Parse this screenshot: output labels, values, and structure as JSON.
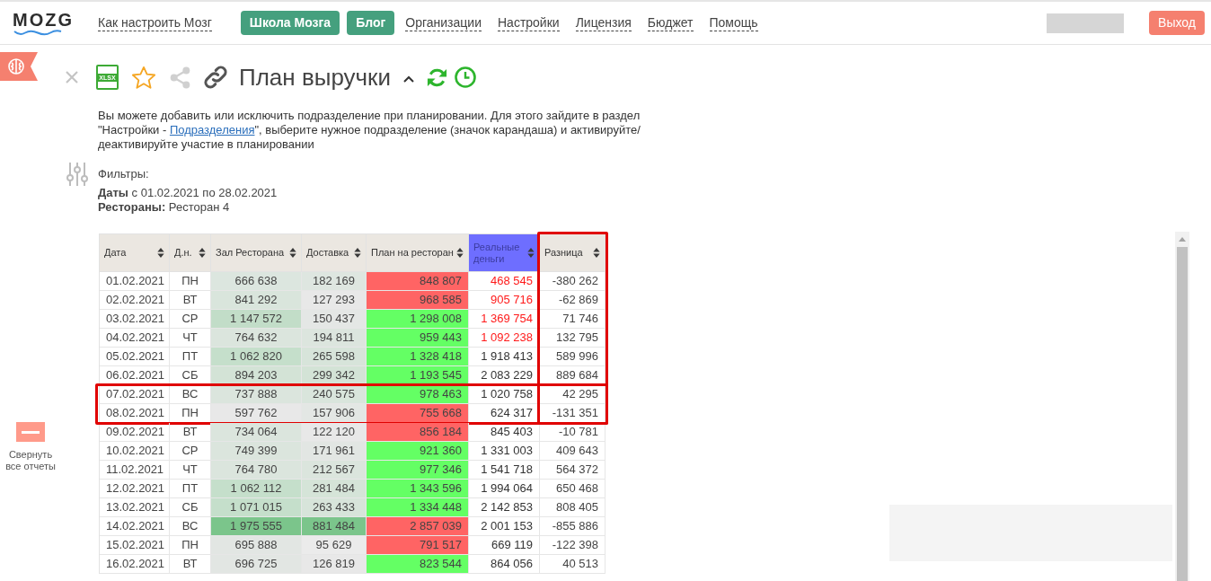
{
  "header": {
    "logo": "MOZG",
    "nav": [
      {
        "kind": "link",
        "label": "Как настроить Мозг"
      },
      {
        "kind": "button",
        "label": "Школа Мозга"
      },
      {
        "kind": "button",
        "label": "Блог"
      },
      {
        "kind": "link",
        "label": "Организации"
      },
      {
        "kind": "link",
        "label": "Настройки"
      },
      {
        "kind": "link",
        "label": "Лицензия"
      },
      {
        "kind": "link",
        "label": "Бюджет"
      },
      {
        "kind": "link",
        "label": "Помощь"
      }
    ],
    "logout": "Выход"
  },
  "sidebar": {
    "collapse_label": "Свернуть все отчеты"
  },
  "report": {
    "export_label": "XLSX",
    "title": "План выручки",
    "notice": {
      "before": "Вы можете добавить или исключить подразделение при планировании. Для этого зайдите в раздел \"Настройки - ",
      "link": "Подразделения",
      "after": "\", выберите нужное подразделение (значок карандаша) и активируйте/деактивируйте участие в планировании"
    },
    "filters": {
      "heading": "Фильтры:",
      "lines": [
        "**Даты** с 01.02.2021 по 28.02.2021",
        "**Рестораны:** Ресторан 4"
      ]
    }
  },
  "table": {
    "columns": [
      {
        "label": "Дата",
        "color": "#ebe7e1",
        "framed": false
      },
      {
        "label": "Д.н.",
        "color": "#ebe7e1",
        "framed": false
      },
      {
        "label": "Зал Ресторана",
        "color": "#ebe7e1",
        "framed": false
      },
      {
        "label": "Доставка",
        "color": "#ebe7e1",
        "framed": false
      },
      {
        "label": "План на ресторан",
        "color": "#ebe7e1",
        "framed": false
      },
      {
        "label": "Реальные деньги",
        "color": "#6e6eff",
        "framed": false
      },
      {
        "label": "Разница",
        "color": "#ebe7e1",
        "framed": true
      }
    ],
    "groups": [
      {
        "framed": false,
        "rows": [
          {
            "date": "01.02.2021",
            "weekday": "ПН",
            "hall": {
              "text": "666 638",
              "color": "#dce6df"
            },
            "delivery": {
              "text": "182 169",
              "color": "#dee6e0"
            },
            "plan": {
              "text": "848 807",
              "color": "#ff6464"
            },
            "real": {
              "text": "468 545",
              "color": "#ff1a1a"
            },
            "diff": "-380 262"
          },
          {
            "date": "02.02.2021",
            "weekday": "ВТ",
            "hall": {
              "text": "841 292",
              "color": "#d9e5dc"
            },
            "delivery": {
              "text": "127 293",
              "color": "#e8e8e8"
            },
            "plan": {
              "text": "968 585",
              "color": "#ff6464"
            },
            "real": {
              "text": "905 716",
              "color": "#ff1a1a"
            },
            "diff": "-62 869"
          },
          {
            "date": "03.02.2021",
            "weekday": "СР",
            "hall": {
              "text": "1 147 572",
              "color": "#c2ddc8"
            },
            "delivery": {
              "text": "150 437",
              "color": "#e4e7e5"
            },
            "plan": {
              "text": "1 298 008",
              "color": "#64ff64"
            },
            "real": {
              "text": "1 369 754",
              "color": "#ff1a1a"
            },
            "diff": "71 746"
          },
          {
            "date": "04.02.2021",
            "weekday": "ЧТ",
            "hall": {
              "text": "764 632",
              "color": "#dbe5dd"
            },
            "delivery": {
              "text": "194 811",
              "color": "#dce5de"
            },
            "plan": {
              "text": "959 443",
              "color": "#64ff64"
            },
            "real": {
              "text": "1 092 238",
              "color": "#ff1a1a"
            },
            "diff": "132 795"
          },
          {
            "date": "05.02.2021",
            "weekday": "ПТ",
            "hall": {
              "text": "1 062 820",
              "color": "#c5dfcb"
            },
            "delivery": {
              "text": "265 598",
              "color": "#d7e4da"
            },
            "plan": {
              "text": "1 328 418",
              "color": "#64ff64"
            },
            "real": {
              "text": "1 918 413",
              "color": "#333333"
            },
            "diff": "589 996"
          },
          {
            "date": "06.02.2021",
            "weekday": "СБ",
            "hall": {
              "text": "894 203",
              "color": "#d3e3d6"
            },
            "delivery": {
              "text": "299 342",
              "color": "#d3e3d6"
            },
            "plan": {
              "text": "1 193 545",
              "color": "#64ff64"
            },
            "real": {
              "text": "2 083 229",
              "color": "#333333"
            },
            "diff": "889 684"
          }
        ]
      },
      {
        "framed": true,
        "rows": [
          {
            "date": "07.02.2021",
            "weekday": "ВС",
            "hall": {
              "text": "737 888",
              "color": "#dbe5dd"
            },
            "delivery": {
              "text": "240 575",
              "color": "#d9e5dc"
            },
            "plan": {
              "text": "978 463",
              "color": "#64ff64"
            },
            "real": {
              "text": "1 020 758",
              "color": "#333333"
            },
            "diff": "42 295"
          },
          {
            "date": "08.02.2021",
            "weekday": "ПН",
            "hall": {
              "text": "597 762",
              "color": "#e8e8e8"
            },
            "delivery": {
              "text": "157 906",
              "color": "#e3e7e4"
            },
            "plan": {
              "text": "755 668",
              "color": "#ff6464"
            },
            "real": {
              "text": "624 317",
              "color": "#333333"
            },
            "diff": "-131 351"
          }
        ]
      },
      {
        "framed": false,
        "rows": [
          {
            "date": "09.02.2021",
            "weekday": "ВТ",
            "hall": {
              "text": "734 064",
              "color": "#dbe5dd"
            },
            "delivery": {
              "text": "122 120",
              "color": "#e8e8e8"
            },
            "plan": {
              "text": "856 184",
              "color": "#ff6464"
            },
            "real": {
              "text": "845 403",
              "color": "#333333"
            },
            "diff": "-10 781"
          },
          {
            "date": "10.02.2021",
            "weekday": "СР",
            "hall": {
              "text": "749 399",
              "color": "#dbe5dd"
            },
            "delivery": {
              "text": "171 961",
              "color": "#e2e6e3"
            },
            "plan": {
              "text": "921 360",
              "color": "#64ff64"
            },
            "real": {
              "text": "1 331 003",
              "color": "#333333"
            },
            "diff": "409 643"
          },
          {
            "date": "11.02.2021",
            "weekday": "ЧТ",
            "hall": {
              "text": "764 780",
              "color": "#dbe5dd"
            },
            "delivery": {
              "text": "212 567",
              "color": "#dbe5dd"
            },
            "plan": {
              "text": "977 346",
              "color": "#64ff64"
            },
            "real": {
              "text": "1 541 718",
              "color": "#333333"
            },
            "diff": "564 372"
          },
          {
            "date": "12.02.2021",
            "weekday": "ПТ",
            "hall": {
              "text": "1 062 112",
              "color": "#c5dfcb"
            },
            "delivery": {
              "text": "281 484",
              "color": "#d5e4d8"
            },
            "plan": {
              "text": "1 343 596",
              "color": "#64ff64"
            },
            "real": {
              "text": "1 994 064",
              "color": "#333333"
            },
            "diff": "650 468"
          },
          {
            "date": "13.02.2021",
            "weekday": "СБ",
            "hall": {
              "text": "1 071 015",
              "color": "#c5dfcb"
            },
            "delivery": {
              "text": "263 433",
              "color": "#d7e4da"
            },
            "plan": {
              "text": "1 334 448",
              "color": "#64ff64"
            },
            "real": {
              "text": "2 142 853",
              "color": "#333333"
            },
            "diff": "808 405"
          },
          {
            "date": "14.02.2021",
            "weekday": "ВС",
            "hall": {
              "text": "1 975 555",
              "color": "#7bc58b"
            },
            "delivery": {
              "text": "881 484",
              "color": "#7bc58b"
            },
            "plan": {
              "text": "2 857 039",
              "color": "#ff6464"
            },
            "real": {
              "text": "2 001 153",
              "color": "#333333"
            },
            "diff": "-855 886"
          },
          {
            "date": "15.02.2021",
            "weekday": "ПН",
            "hall": {
              "text": "695 888",
              "color": "#e2e6e3"
            },
            "delivery": {
              "text": "95 629",
              "color": "#ebebeb"
            },
            "plan": {
              "text": "791 517",
              "color": "#ff6464"
            },
            "real": {
              "text": "669 119",
              "color": "#333333"
            },
            "diff": "-122 398"
          },
          {
            "date": "16.02.2021",
            "weekday": "ВТ",
            "hall": {
              "text": "696 725",
              "color": "#e2e6e3"
            },
            "delivery": {
              "text": "126 819",
              "color": "#e8e8e8"
            },
            "plan": {
              "text": "823 544",
              "color": "#64ff64"
            },
            "real": {
              "text": "864 056",
              "color": "#333333"
            },
            "diff": "40 513"
          }
        ]
      }
    ]
  }
}
